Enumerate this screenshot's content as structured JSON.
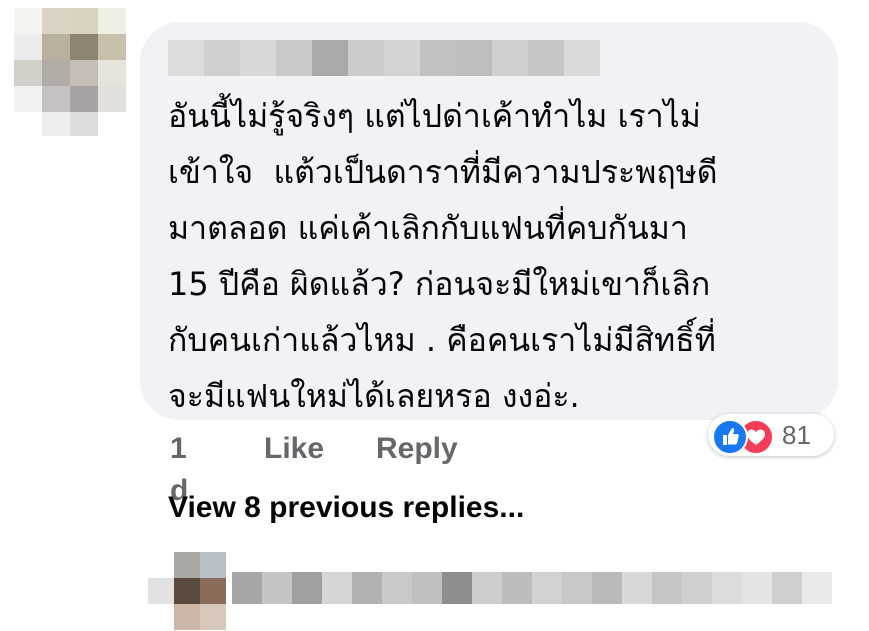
{
  "comment": {
    "author_name": "",
    "lines": [
      "อันนี้ไม่รู้จริงๆ แต่ไปด่าเค้าทำไม เราไม่",
      "เข้าใจ  แต้วเป็นดาราที่มีความประพฤษดี",
      "มาตลอด แค่เค้าเลิกกับแฟนที่คบกันมา",
      "15 ปีคือ ผิดแล้ว? ก่อนจะมีใหม่เขาก็เลิก",
      "กับคนเก่าแล้วไหม . คือคนเราไม่มีสิทธิ์ที่",
      "จะมีแฟนใหม่ได้เลยหรอ งงอ่ะ."
    ],
    "time": "1 d",
    "like_label": "Like",
    "reply_label": "Reply",
    "reaction_count": "81",
    "reaction_icons": [
      "like-icon",
      "love-icon"
    ]
  },
  "view_previous_label": "View 8 previous replies...",
  "colors": {
    "bubble_bg": "#f0f2f5",
    "text": "#050505",
    "meta": "#65676b",
    "like_blue": "#1877f2",
    "love_red": "#f33e58"
  }
}
